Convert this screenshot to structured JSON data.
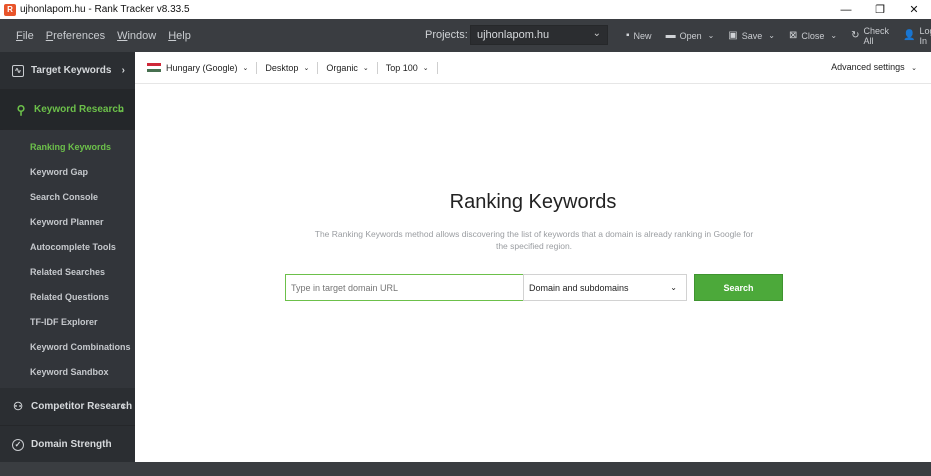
{
  "window": {
    "title": "ujhonlapom.hu - Rank Tracker v8.33.5",
    "app_icon_letter": "R",
    "controls": {
      "minimize": "—",
      "restore": "❐",
      "close": "✕"
    }
  },
  "menu": {
    "items": [
      {
        "key": "F",
        "rest": "ile"
      },
      {
        "key": "P",
        "rest": "references"
      },
      {
        "key": "W",
        "rest": "indow"
      },
      {
        "key": "H",
        "rest": "elp"
      }
    ],
    "projects_label": "Projects:",
    "project_value": "ujhonlapom.hu",
    "toolbar": {
      "new": "New",
      "open": "Open",
      "save": "Save",
      "close": "Close",
      "check_all": "Check All",
      "login": "Log In"
    }
  },
  "sidebar": {
    "target_keywords": "Target Keywords",
    "keyword_research": "Keyword Research",
    "sub_items": [
      "Ranking Keywords",
      "Keyword Gap",
      "Search Console",
      "Keyword Planner",
      "Autocomplete Tools",
      "Related Searches",
      "Related Questions",
      "TF-IDF Explorer",
      "Keyword Combinations",
      "Keyword Sandbox"
    ],
    "competitor_research": "Competitor Research",
    "domain_strength": "Domain Strength"
  },
  "filters": {
    "region": "Hungary (Google)",
    "device": "Desktop",
    "type": "Organic",
    "top": "Top 100",
    "advanced": "Advanced settings"
  },
  "flag_colors": [
    "#ce2939",
    "#ffffff",
    "#477050"
  ],
  "main": {
    "title": "Ranking Keywords",
    "description": "The Ranking Keywords method allows discovering the list of keywords that a domain is already ranking in Google for the specified region.",
    "input_placeholder": "Type in target domain URL",
    "scope_value": "Domain and subdomains",
    "search_label": "Search"
  },
  "colors": {
    "accent_green": "#6cc04a",
    "button_green": "#4ca93a",
    "sidebar_bg": "#2b2e32",
    "menubar_bg": "#3a3d41"
  }
}
